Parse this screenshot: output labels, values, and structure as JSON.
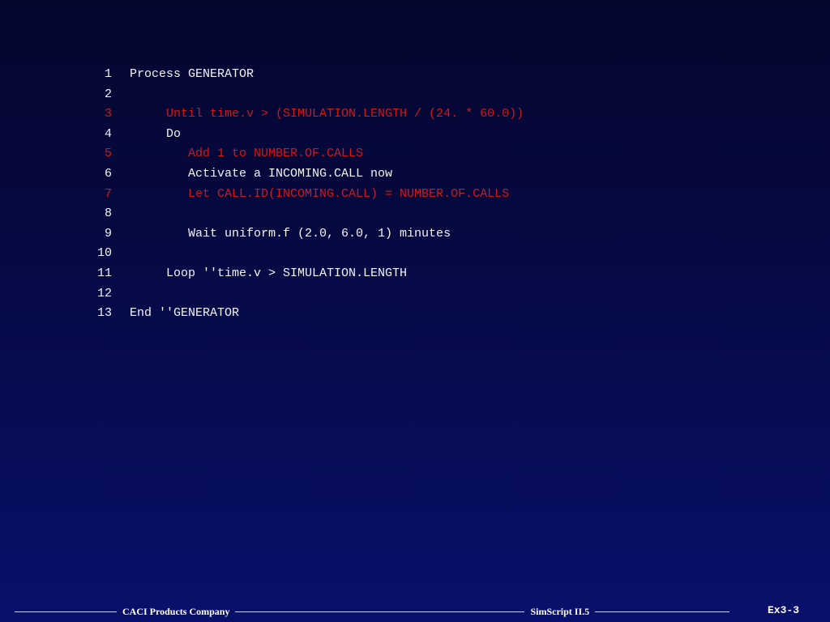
{
  "code": {
    "lines": [
      {
        "number": "1",
        "text": "Process GENERATOR",
        "color": "#f3f3f3"
      },
      {
        "number": "2",
        "text": "",
        "color": "#f3f3f3"
      },
      {
        "number": "3",
        "text": "     Until time.v > (SIMULATION.LENGTH / (24. * 60.0))",
        "color": "#d01818"
      },
      {
        "number": "4",
        "text": "     Do",
        "color": "#f3f3f3"
      },
      {
        "number": "5",
        "text": "        Add 1 to NUMBER.OF.CALLS",
        "color": "#d01818"
      },
      {
        "number": "6",
        "text": "        Activate a INCOMING.CALL now",
        "color": "#f3f3f3"
      },
      {
        "number": "7",
        "text": "        Let CALL.ID(INCOMING.CALL) = NUMBER.OF.CALLS",
        "color": "#d01818"
      },
      {
        "number": "8",
        "text": "",
        "color": "#f3f3f3"
      },
      {
        "number": "9",
        "text": "        Wait uniform.f (2.0, 6.0, 1) minutes",
        "color": "#f3f3f3"
      },
      {
        "number": "10",
        "text": "",
        "color": "#f3f3f3"
      },
      {
        "number": "11",
        "text": "     Loop ''time.v > SIMULATION.LENGTH",
        "color": "#f3f3f3"
      },
      {
        "number": "12",
        "text": "",
        "color": "#f3f3f3"
      },
      {
        "number": "13",
        "text": "End ''GENERATOR",
        "color": "#f3f3f3"
      }
    ]
  },
  "footer": {
    "company": "CACI Products Company",
    "product": "SimScript II.5",
    "page": "Ex3-3"
  }
}
